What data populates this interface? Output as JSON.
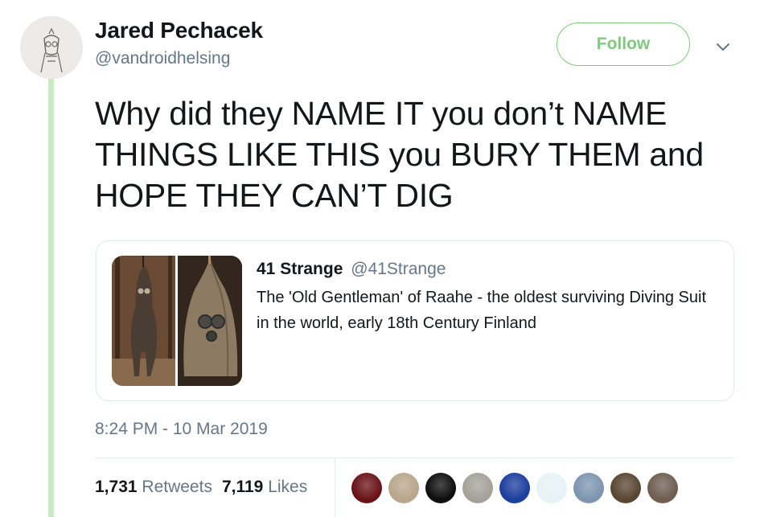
{
  "author": {
    "display_name": "Jared Pechacek",
    "handle": "@vandroidhelsing"
  },
  "follow_label": "Follow",
  "tweet_text": "Why did they NAME IT you don’t NAME THINGS LIKE THIS you BURY THEM and HOPE THEY CAN’T DIG",
  "quote": {
    "name": "41 Strange",
    "handle": "@41Strange",
    "text": "The 'Old Gentleman' of  Raahe - the oldest surviving Diving Suit in the world, early 18th Century Finland"
  },
  "timestamp": "8:24 PM - 10 Mar 2019",
  "stats": {
    "retweets_count": "1,731",
    "retweets_label": "Retweets",
    "likes_count": "7,119",
    "likes_label": "Likes"
  },
  "liker_avatars": [
    {
      "name": "liker-avatar-1",
      "color": "#6a1418"
    },
    {
      "name": "liker-avatar-2",
      "color": "#b9a68d"
    },
    {
      "name": "liker-avatar-3",
      "color": "#0f0f0f"
    },
    {
      "name": "liker-avatar-4",
      "color": "#a4a39a"
    },
    {
      "name": "liker-avatar-5",
      "color": "#1d3f9e"
    },
    {
      "name": "liker-avatar-6",
      "color": "#e7f2f7"
    },
    {
      "name": "liker-avatar-7",
      "color": "#7e96b0"
    },
    {
      "name": "liker-avatar-8",
      "color": "#5a4733"
    },
    {
      "name": "liker-avatar-9",
      "color": "#6f5f52"
    }
  ],
  "colors": {
    "accent_green": "#7fc97c",
    "thread_line": "#c8ecc2",
    "muted_text": "#657786"
  }
}
